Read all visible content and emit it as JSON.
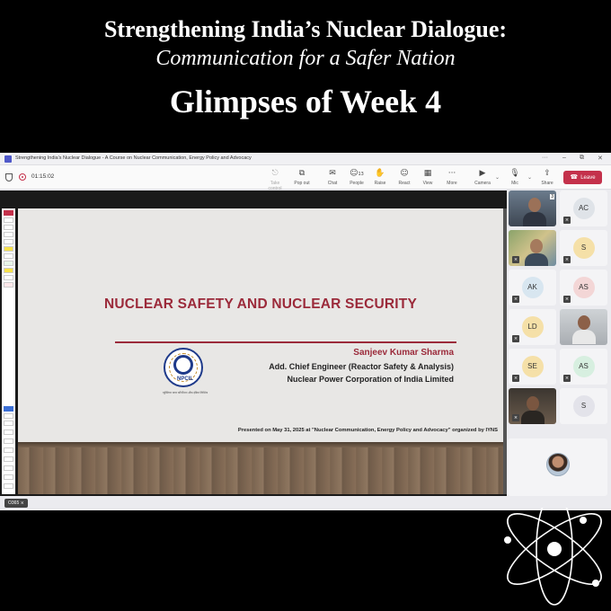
{
  "banner": {
    "title": "Strengthening India’s Nuclear Dialogue:",
    "subtitle": "Communication for a Safer Nation",
    "heading": "Glimpses of Week 4"
  },
  "window": {
    "title": "Strengthening India's Nuclear Dialogue - A Course on Nuclear Communication, Energy Policy and Advocacy",
    "controls": [
      "···",
      "–",
      "⧉",
      "✕"
    ]
  },
  "toolbar": {
    "timer": "01:15:02",
    "buttons": [
      {
        "label": "Take control",
        "icon": "⎋"
      },
      {
        "label": "Pop out",
        "icon": "⧉"
      },
      {
        "label": "Chat",
        "icon": "✉"
      },
      {
        "label": "People",
        "icon": "☺",
        "count": "13"
      },
      {
        "label": "Raise",
        "icon": "✋"
      },
      {
        "label": "React",
        "icon": "☺"
      },
      {
        "label": "View",
        "icon": "▦"
      },
      {
        "label": "More",
        "icon": "···"
      },
      {
        "label": "Camera",
        "icon": "▶"
      },
      {
        "label": "Mic",
        "icon": "🎙"
      },
      {
        "label": "Share",
        "icon": "⇪"
      }
    ],
    "leave_label": "Leave",
    "leave_icon": "☎",
    "chevron": "⌄"
  },
  "slide": {
    "title": "NUCLEAR SAFETY AND NUCLEAR SECURITY",
    "logo_text": "NPCIL",
    "logo_sub": "न्यूक्लियर पावर कॉर्पोरेशन ऑफ इंडिया लिमिटेड",
    "speaker_name": "Sanjeev Kumar Sharma",
    "speaker_role": "Add. Chief Engineer (Reactor Safety & Analysis)",
    "speaker_org": "Nuclear Power Corporation of India Limited",
    "presented": "Presented on  May 31, 2025  at \"Nuclear Communication, Energy Policy and Advocacy\" organized by IYNS"
  },
  "participants": [
    {
      "initials": "",
      "video": true,
      "badge": "3"
    },
    {
      "initials": "AC",
      "color": "#dfe3e8"
    },
    {
      "initials": "",
      "video": true
    },
    {
      "initials": "S",
      "color": "#f5e0a8"
    },
    {
      "initials": "AK",
      "color": "#d8e6f0"
    },
    {
      "initials": "AS",
      "color": "#f3d6d6"
    },
    {
      "initials": "LD",
      "color": "#f5e0a8"
    },
    {
      "initials": "",
      "video": true
    },
    {
      "initials": "SE",
      "color": "#f5e0a8"
    },
    {
      "initials": "AS",
      "color": "#d7efe0"
    },
    {
      "initials": "",
      "video": true
    },
    {
      "initials": "S",
      "color": "#e3e3ea"
    }
  ],
  "status": {
    "o365_label": "O365"
  }
}
